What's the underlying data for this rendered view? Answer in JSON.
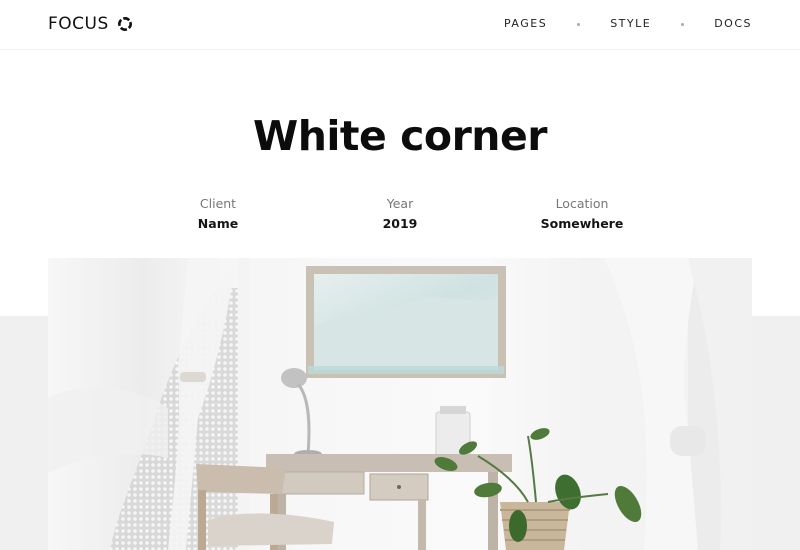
{
  "logo": {
    "text": "FOCUS",
    "icon": "ring-icon"
  },
  "nav": {
    "items": [
      "PAGES",
      "STYLE",
      "DOCS"
    ]
  },
  "page": {
    "title": "White corner"
  },
  "meta": [
    {
      "label": "Client",
      "value": "Name"
    },
    {
      "label": "Year",
      "value": "2019"
    },
    {
      "label": "Location",
      "value": "Somewhere"
    }
  ],
  "colors": {
    "background": "#ffffff",
    "band": "#f0f0f0",
    "text": "#111111",
    "muted": "#777777"
  }
}
